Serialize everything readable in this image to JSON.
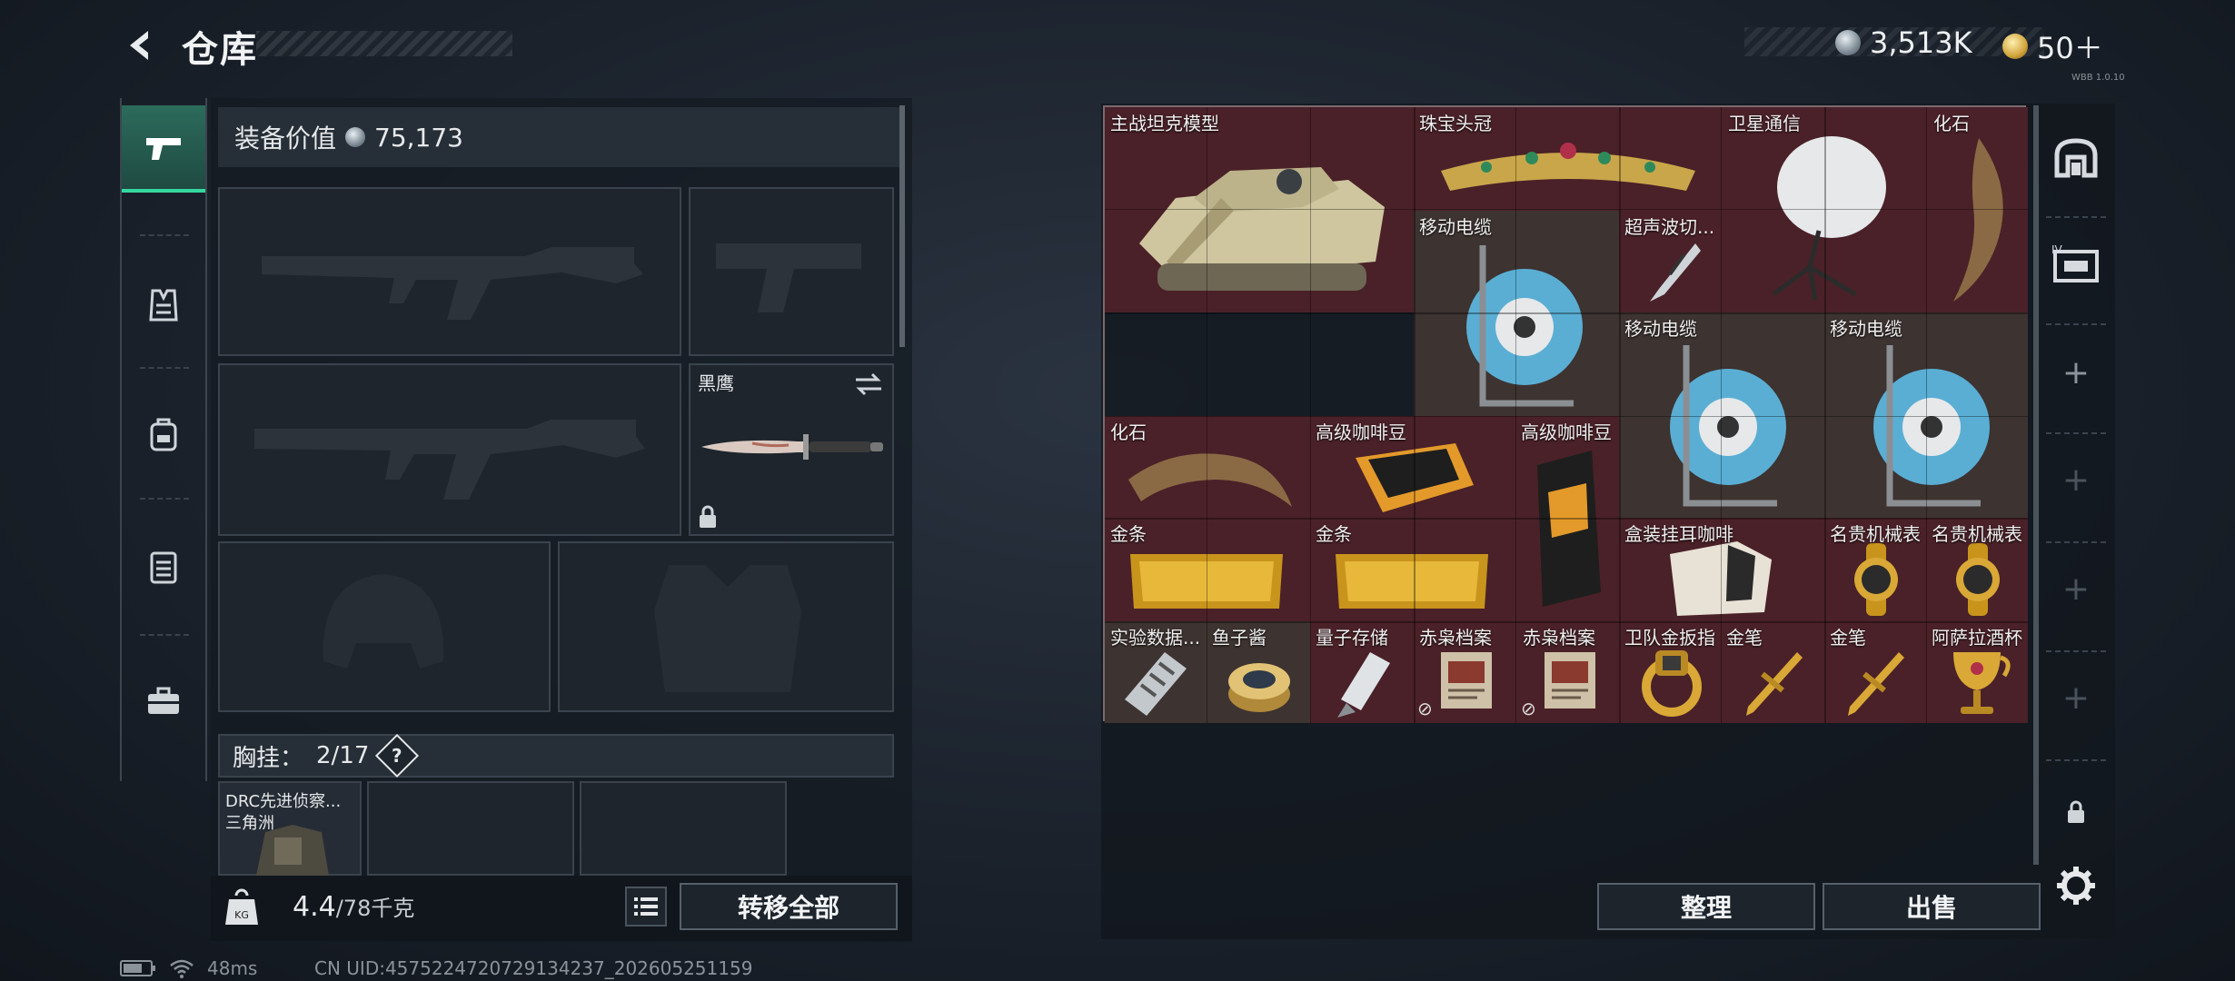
{
  "header": {
    "title": "仓库",
    "silver_amount": "3,513K",
    "gold_amount": "50＋",
    "small_code": "WBB 1.0.10"
  },
  "equipment": {
    "value_label": "装备价值",
    "value": "75,173",
    "melee_name": "黑鹰",
    "chest_label": "胸挂：",
    "chest_count": "2/17",
    "chest_help": "?",
    "chest_item_name": "DRC先进侦察...",
    "chest_item_sub": "三角洲",
    "weight": "4.4",
    "weight_max": "/78千克",
    "transfer_all": "转移全部"
  },
  "storage": {
    "items": [
      {
        "name": "主战坦克模型",
        "rarity": "red"
      },
      {
        "name": "珠宝头冠",
        "rarity": "red"
      },
      {
        "name": "卫星通信",
        "rarity": "red"
      },
      {
        "name": "化石",
        "rarity": "red"
      },
      {
        "name": "移动电缆",
        "rarity": "brown"
      },
      {
        "name": "超声波切...",
        "rarity": "red"
      },
      {
        "name": "移动电缆",
        "rarity": "brown"
      },
      {
        "name": "移动电缆",
        "rarity": "brown"
      },
      {
        "name": "化石",
        "rarity": "red"
      },
      {
        "name": "高级咖啡豆",
        "rarity": "red"
      },
      {
        "name": "高级咖啡豆",
        "rarity": "red"
      },
      {
        "name": "金条",
        "rarity": "red"
      },
      {
        "name": "金条",
        "rarity": "red"
      },
      {
        "name": "盒装挂耳咖啡",
        "rarity": "red"
      },
      {
        "name": "名贵机械表",
        "rarity": "red"
      },
      {
        "name": "名贵机械表",
        "rarity": "red"
      },
      {
        "name": "实验数据...",
        "rarity": "brown"
      },
      {
        "name": "鱼子酱",
        "rarity": "brown"
      },
      {
        "name": "量子存储",
        "rarity": "red"
      },
      {
        "name": "赤枭档案",
        "rarity": "red"
      },
      {
        "name": "赤枭档案",
        "rarity": "red"
      },
      {
        "name": "卫队金扳指",
        "rarity": "red"
      },
      {
        "name": "金笔",
        "rarity": "red"
      },
      {
        "name": "金笔",
        "rarity": "red"
      },
      {
        "name": "阿萨拉酒杯",
        "rarity": "red"
      }
    ],
    "organize": "整理",
    "sell": "出售"
  },
  "status": {
    "ping": "48ms",
    "uid": "CN UID:4575224720729134237_202605251159"
  },
  "colors": {
    "accent_green": "#35d7a0",
    "cell_red": "#4a2128",
    "cell_brown": "#3d3330"
  }
}
